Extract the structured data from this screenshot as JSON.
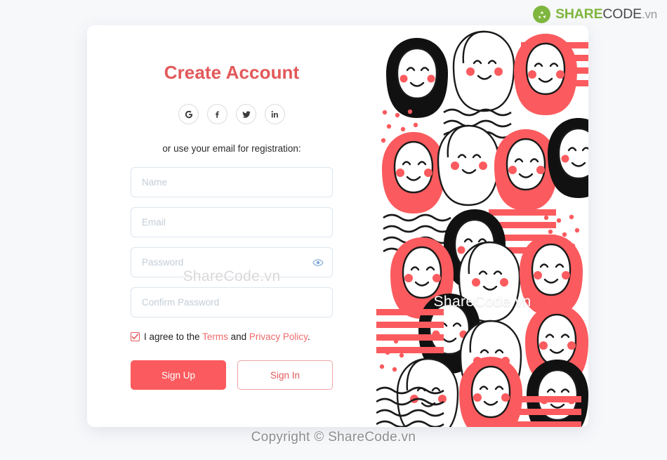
{
  "brand": {
    "mark_icon": "recycle-circle-icon",
    "share": "SHARE",
    "code": "CODE",
    "tld": ".vn"
  },
  "form": {
    "title": "Create Account",
    "social_label": "or use your email for registration:",
    "social_buttons": [
      {
        "name": "google-icon",
        "label": "G"
      },
      {
        "name": "facebook-icon",
        "label": "f"
      },
      {
        "name": "twitter-icon",
        "label": "t"
      },
      {
        "name": "linkedin-icon",
        "label": "in"
      }
    ],
    "fields": [
      {
        "name": "name-input",
        "placeholder": "Name",
        "value": "",
        "type": "text",
        "eye": false
      },
      {
        "name": "email-input",
        "placeholder": "Email",
        "value": "",
        "type": "text",
        "eye": false
      },
      {
        "name": "password-input",
        "placeholder": "Password",
        "value": "",
        "type": "password",
        "eye": true
      },
      {
        "name": "confirm-password-input",
        "placeholder": "Confirm Password",
        "value": "",
        "type": "password",
        "eye": false
      }
    ],
    "terms": {
      "checked": true,
      "prefix": "I agree to the ",
      "terms_link": "Terms",
      "middle": " and ",
      "privacy_link": "Privacy Policy",
      "suffix": "."
    },
    "sign_up_label": "Sign Up",
    "sign_in_label": "Sign In"
  },
  "watermarks": {
    "form": "ShareCode.vn",
    "art": "ShareCode.vn"
  },
  "footer": {
    "copyright": "Copyright © ShareCode.vn"
  },
  "colors": {
    "accent": "#FB5B5E",
    "title": "#E2595A",
    "link": "#EF6B6B",
    "brand_green": "#7FB63F",
    "page_bg": "#F7F8FA",
    "input_border": "#DBE5EE",
    "eye": "#7FA8D8"
  },
  "illustration": {
    "name": "people-faces-pattern",
    "description": "Repeating flat-illustration pattern of stylized smiling faces and figures in coral red, black and white."
  }
}
